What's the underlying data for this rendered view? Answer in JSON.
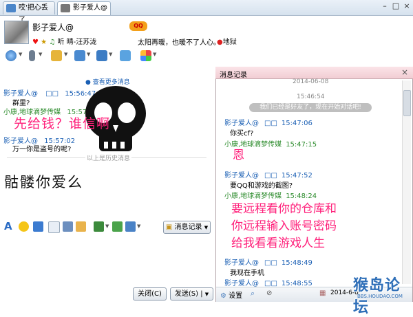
{
  "tabs": [
    {
      "label": "哎'把心丢了"
    },
    {
      "label": "影子爱人@"
    }
  ],
  "window_buttons": {
    "minimize": "–",
    "maximize": "□",
    "close": "×"
  },
  "header": {
    "name": "影子爱人@",
    "status": "听 晴-汪苏泷",
    "signature": "太阳再暖，也暖不了人心。",
    "location": "地狱",
    "qq_badge": "QQ"
  },
  "chat": {
    "view_more": "查看更多消息",
    "messages": [
      {
        "sender": "影子爱人@",
        "time": "15:56:47",
        "text": "群里?"
      },
      {
        "sender": "小康,地球滴梦传媒",
        "time": "15:57:01",
        "text": ""
      },
      {
        "sender": "影子爱人@",
        "time": "15:57:02",
        "text": "万一你是盗号的呢?"
      }
    ],
    "history_divider": "以上是历史消息",
    "overlay_top": "先给钱？谁信啊",
    "overlay_bottom": "骷髅你爱么",
    "id_mask": "□□"
  },
  "lower_toolbar": {
    "history_button": "消息记录"
  },
  "buttons": {
    "close": "关闭(C)",
    "send": "发送(S)",
    "send_arrow": "▼"
  },
  "history": {
    "title": "消息记录",
    "date_top": "2014-06-08",
    "time_mid": "15:46:54",
    "notice": "我们已经是好友了，现在开始对话吧!",
    "entries": [
      {
        "sender": "影子爱人@",
        "time": "15:47:06",
        "text": "你买cf?",
        "kind": "a"
      },
      {
        "sender": "小康,地球滴梦传媒",
        "time": "15:47:15",
        "text": "恩",
        "kind": "b"
      },
      {
        "sender": "影子爱人@",
        "time": "15:47:52",
        "text": "要QQ和游戏的截图?",
        "kind": "a"
      },
      {
        "sender": "小康,地球滴梦传媒",
        "time": "15:48:24",
        "text": "",
        "kind": "b"
      },
      {
        "sender": "影子爱人@",
        "time": "15:48:49",
        "text": "我现在手机",
        "kind": "a"
      },
      {
        "sender": "影子爱人@",
        "time": "15:48:55",
        "text": "",
        "kind": "a"
      }
    ],
    "pink_lines": [
      "要远程看你的仓库和",
      "你远程输入账号密码",
      "给我看看游戏人生"
    ],
    "footer_settings": "设置",
    "footer_date": "2014-6-8",
    "close_x": "×",
    "id_mask": "□□"
  },
  "watermark": {
    "main": "猴岛论坛",
    "sub": "BBS.HOUDAO.COM"
  },
  "colors": {
    "accent": "#1a5fb4",
    "pink": "#ff1f7a",
    "green": "#2a8a2a"
  }
}
